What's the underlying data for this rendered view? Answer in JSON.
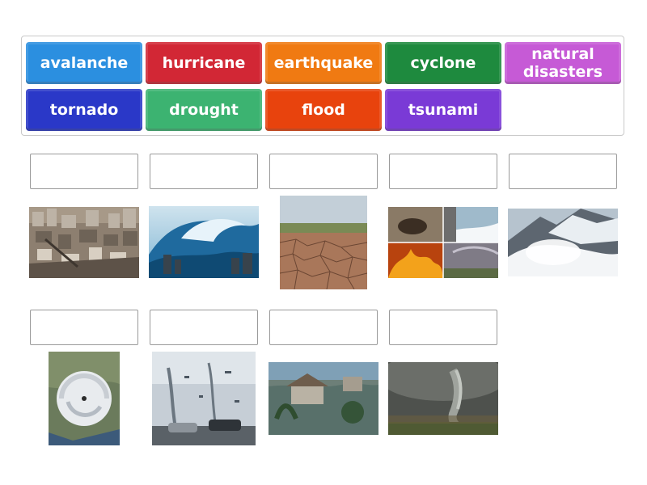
{
  "tiles": [
    {
      "label": "avalanche",
      "color": "#2b8fe0"
    },
    {
      "label": "hurricane",
      "color": "#d22735"
    },
    {
      "label": "earthquake",
      "color": "#f07a12"
    },
    {
      "label": "cyclone",
      "color": "#1e8a3e"
    },
    {
      "label": "natural disasters",
      "color": "#c65ad6"
    },
    {
      "label": "tornado",
      "color": "#2a38c8"
    },
    {
      "label": "drought",
      "color": "#3cb371"
    },
    {
      "label": "flood",
      "color": "#e8430d"
    },
    {
      "label": "tsunami",
      "color": "#7a3ad6"
    }
  ],
  "drop_slots": 9,
  "images": [
    {
      "icon": "earthquake-ruins-image"
    },
    {
      "icon": "tsunami-wave-image"
    },
    {
      "icon": "drought-cracked-earth-image"
    },
    {
      "icon": "natural-disasters-collage-image"
    },
    {
      "icon": "avalanche-image"
    },
    {
      "icon": "cyclone-satellite-image"
    },
    {
      "icon": "hurricane-storm-image"
    },
    {
      "icon": "flood-image"
    },
    {
      "icon": "tornado-image"
    }
  ]
}
